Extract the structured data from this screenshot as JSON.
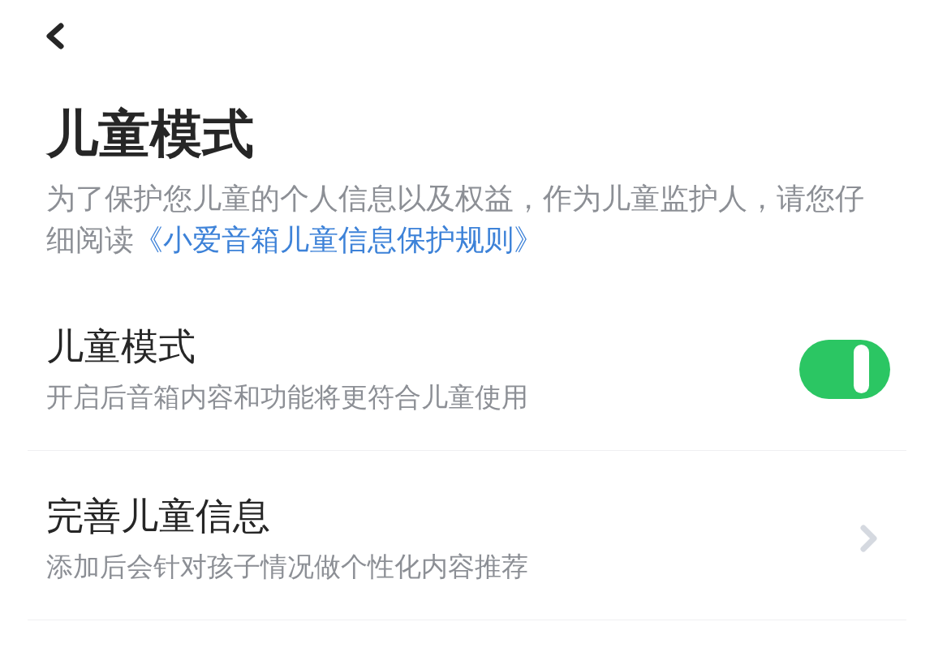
{
  "header": {
    "title": "儿童模式"
  },
  "description": {
    "text": "为了保护您儿童的个人信息以及权益，作为儿童监护人，请您仔细阅读",
    "link": "《小爱音箱儿童信息保护规则》"
  },
  "settings": [
    {
      "kind": "toggle",
      "title": "儿童模式",
      "subtitle": "开启后音箱内容和功能将更符合儿童使用",
      "on": true
    },
    {
      "kind": "link",
      "title": "完善儿童信息",
      "subtitle": "添加后会针对孩子情况做个性化内容推荐"
    }
  ]
}
